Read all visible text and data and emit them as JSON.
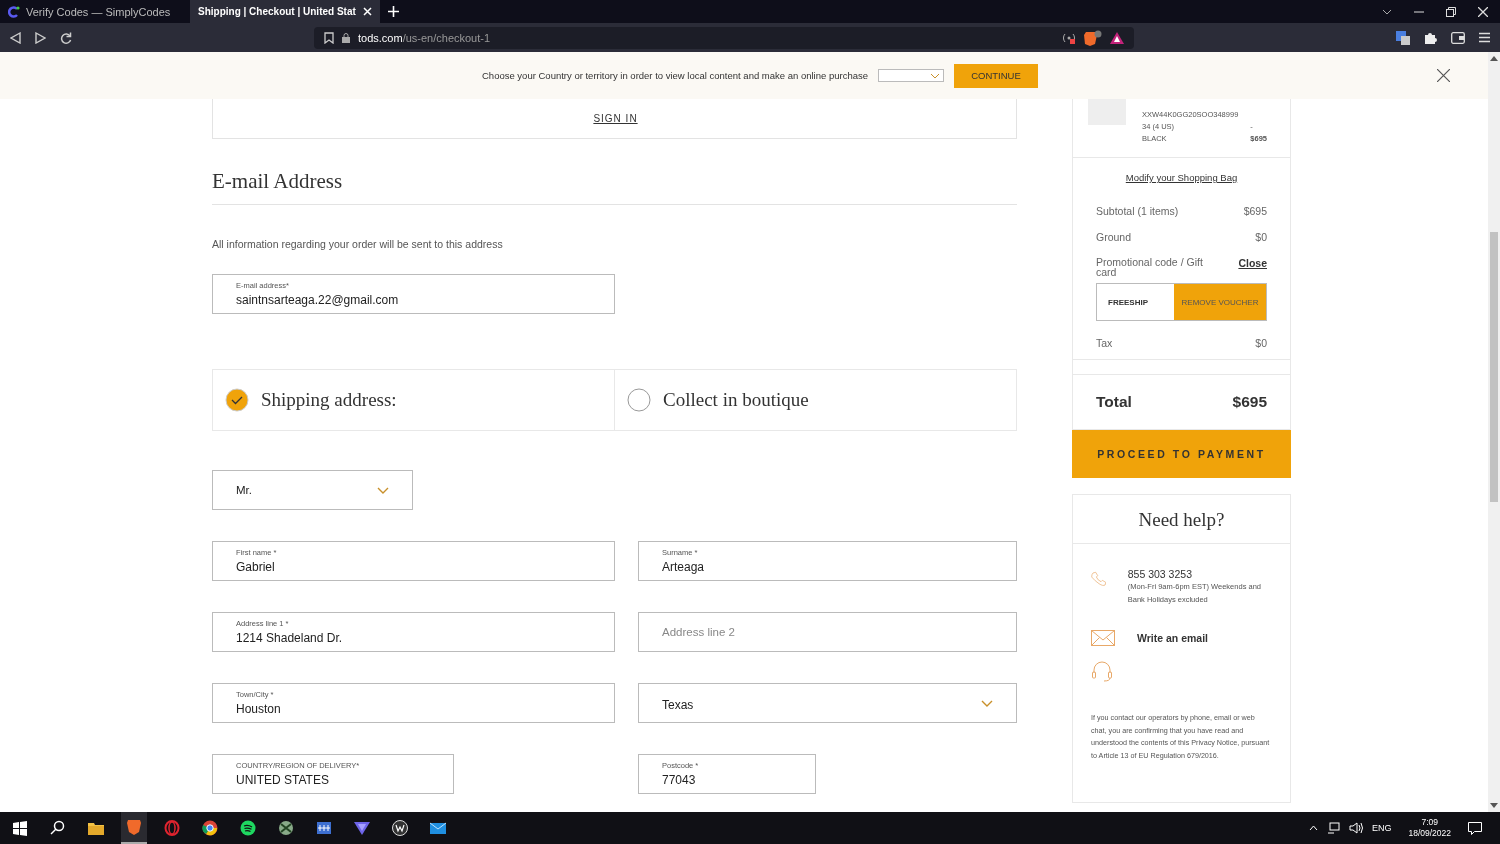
{
  "browser": {
    "tabs": [
      {
        "title": "Verify Codes — SimplyCodes",
        "selected": false
      },
      {
        "title": "Shipping | Checkout | United Stat",
        "selected": true
      }
    ],
    "url_host": "tods.com",
    "url_path": "/us-en/checkout-1"
  },
  "country_banner": {
    "message": "Choose your Country or territory in order to view local content and make an online purchase",
    "button": "CONTINUE"
  },
  "sign_in": "SIGN IN",
  "email_section": {
    "heading": "E-mail Address",
    "note": "All information regarding your order will be sent to this address",
    "field": {
      "label": "E-mail address*",
      "value": "saintnsarteaga.22@gmail.com"
    }
  },
  "delivery_options": [
    {
      "label": "Shipping address:",
      "selected": true
    },
    {
      "label": "Collect in boutique",
      "selected": false
    }
  ],
  "address_form": {
    "title_select": "Mr.",
    "fields": [
      {
        "kind": "input",
        "label": "First name *",
        "value": "Gabriel"
      },
      {
        "kind": "input",
        "label": "Surname *",
        "value": "Arteaga"
      },
      {
        "kind": "input",
        "label": "Address line 1 *",
        "value": "1214 Shadeland Dr."
      },
      {
        "kind": "empty",
        "placeholder": "Address line 2"
      },
      {
        "kind": "input",
        "label": "Town/City *",
        "value": "Houston"
      },
      {
        "kind": "select",
        "value": "Texas"
      },
      {
        "kind": "input",
        "label": "COUNTRY/REGION OF DELIVERY*",
        "value": "UNITED STATES"
      },
      {
        "kind": "input",
        "label": "Postcode *",
        "value": "77043"
      }
    ]
  },
  "order_summary": {
    "item": {
      "sku": "XXW44K0GG20SOO348999",
      "size": "34 (4 US)",
      "dash": "-",
      "variant": "BLACK",
      "price": "$695"
    },
    "modify_link": "Modify your Shopping Bag",
    "rows": [
      {
        "label": "Subtotal (1 items)",
        "value": "$695"
      },
      {
        "label": "Ground",
        "value": "$0"
      }
    ],
    "promo": {
      "label": "Promotional code / Gift card",
      "close": "Close",
      "code": "FREESHIP",
      "button": "REMOVE VOUCHER"
    },
    "tax": {
      "label": "Tax",
      "value": "$0"
    },
    "total": {
      "label": "Total",
      "value": "$695"
    },
    "proceed_button": "PROCEED TO PAYMENT"
  },
  "help": {
    "title": "Need help?",
    "phone": "855 303 3253",
    "hours": "(Mon-Fri 9am-6pm EST) Weekends and Bank Holidays excluded",
    "email": "Write an email",
    "disclaimer": "If you contact our operators by phone, email or web chat, you are confirming that you have read and understood the contents of this Privacy Notice, pursuant to Article 13 of EU Regulation 679/2016."
  },
  "taskbar": {
    "language": "ENG",
    "time": "7:09",
    "date": "18/09/2022"
  }
}
